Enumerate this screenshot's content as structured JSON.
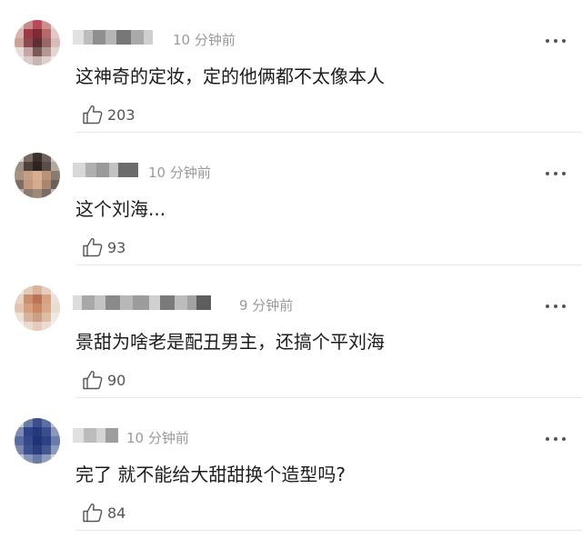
{
  "comments": [
    {
      "time": "10 分钟前",
      "text": "这神奇的定妆，定的他俩都不太像本人",
      "likes": "203",
      "avatar_colors": [
        "#e6c8c8",
        "#c78a8a",
        "#b64a58",
        "#d18c8c",
        "#e8d6d6",
        "#d8b4b0",
        "#9c3a46",
        "#7e2b34",
        "#b46a6a",
        "#e2c9c6",
        "#caa29c",
        "#8d4a4e",
        "#5c3034",
        "#9b6764",
        "#d7bcb8",
        "#e8dcda",
        "#c4a7a3",
        "#7a5a58",
        "#b49692",
        "#e4d4d2",
        "#f0e8e6",
        "#dccbc8",
        "#c9b5b2",
        "#dfd0ce",
        "#f2ebea"
      ],
      "name_blocks": [
        "#e2e2e2",
        "#bdbdbd",
        "#8f8f8f",
        "#b5b5b5",
        "#777777",
        "#a9a9a9",
        "#cfcfcf"
      ]
    },
    {
      "time": "10 分钟前",
      "text": "这个刘海...",
      "likes": "93",
      "avatar_colors": [
        "#d8d4d0",
        "#7b6a64",
        "#3a302d",
        "#6e5f58",
        "#cfc8c2",
        "#9c8e86",
        "#4e403a",
        "#2c2420",
        "#5a4c46",
        "#b4a8a0",
        "#a89284",
        "#c69e84",
        "#d8b091",
        "#b99378",
        "#8a7a70",
        "#7c6c64",
        "#c09a80",
        "#d6aa8c",
        "#a88670",
        "#6c6059",
        "#b8b0aa",
        "#8e7c70",
        "#9e8878",
        "#7a6c62",
        "#c4bcb6"
      ],
      "name_blocks": [
        "#d8d8d8",
        "#b0b0b0",
        "#9a9a9a",
        "#c2c2c2",
        "#6c6c6c"
      ]
    },
    {
      "time": "9 分钟前",
      "text": "景甜为啥老是配丑男主，还搞个平刘海",
      "likes": "90",
      "avatar_colors": [
        "#efe6df",
        "#e2cbbb",
        "#d9b39a",
        "#e6cdbd",
        "#f2ebe6",
        "#e8d2c2",
        "#c98f6e",
        "#b97553",
        "#d4a285",
        "#ece0d8",
        "#e4c6b0",
        "#d69f7d",
        "#c88865",
        "#d8a88a",
        "#eadbd0",
        "#ede1d8",
        "#d9b49c",
        "#caa084",
        "#ddbca6",
        "#f1e8e2",
        "#f5efeb",
        "#ecdcd0",
        "#e4ccbc",
        "#ecdcd2",
        "#f6f1ee"
      ],
      "name_blocks": [
        "#dcdcdc",
        "#a8a8a8",
        "#c4c4c4",
        "#8a8a8a",
        "#b8b8b8",
        "#9c9c9c",
        "#d0d0d0",
        "#7a7a7a",
        "#bcbcbc",
        "#a2a2a2",
        "#5e5e5e"
      ]
    },
    {
      "time": "10 分钟前",
      "text": "完了 就不能给大甜甜换个造型吗?",
      "likes": "84",
      "avatar_colors": [
        "#c8ccd8",
        "#6a7aa6",
        "#3c4f8c",
        "#5d6ea0",
        "#b9c0d4",
        "#7c8cb4",
        "#2e4486",
        "#243a7c",
        "#3a4e8e",
        "#8a98bc",
        "#5a6c9e",
        "#34488a",
        "#1e3476",
        "#2c4284",
        "#6a7ca8",
        "#7888b0",
        "#3c508e",
        "#2a3e80",
        "#44588f",
        "#8c9abc",
        "#c0c6d6",
        "#8896b8",
        "#6a7aa4",
        "#909cbc",
        "#ccd0dc"
      ],
      "name_blocks": [
        "#e0e0e0",
        "#bcbcbc",
        "#d4d4d4",
        "#9e9e9e"
      ]
    }
  ]
}
